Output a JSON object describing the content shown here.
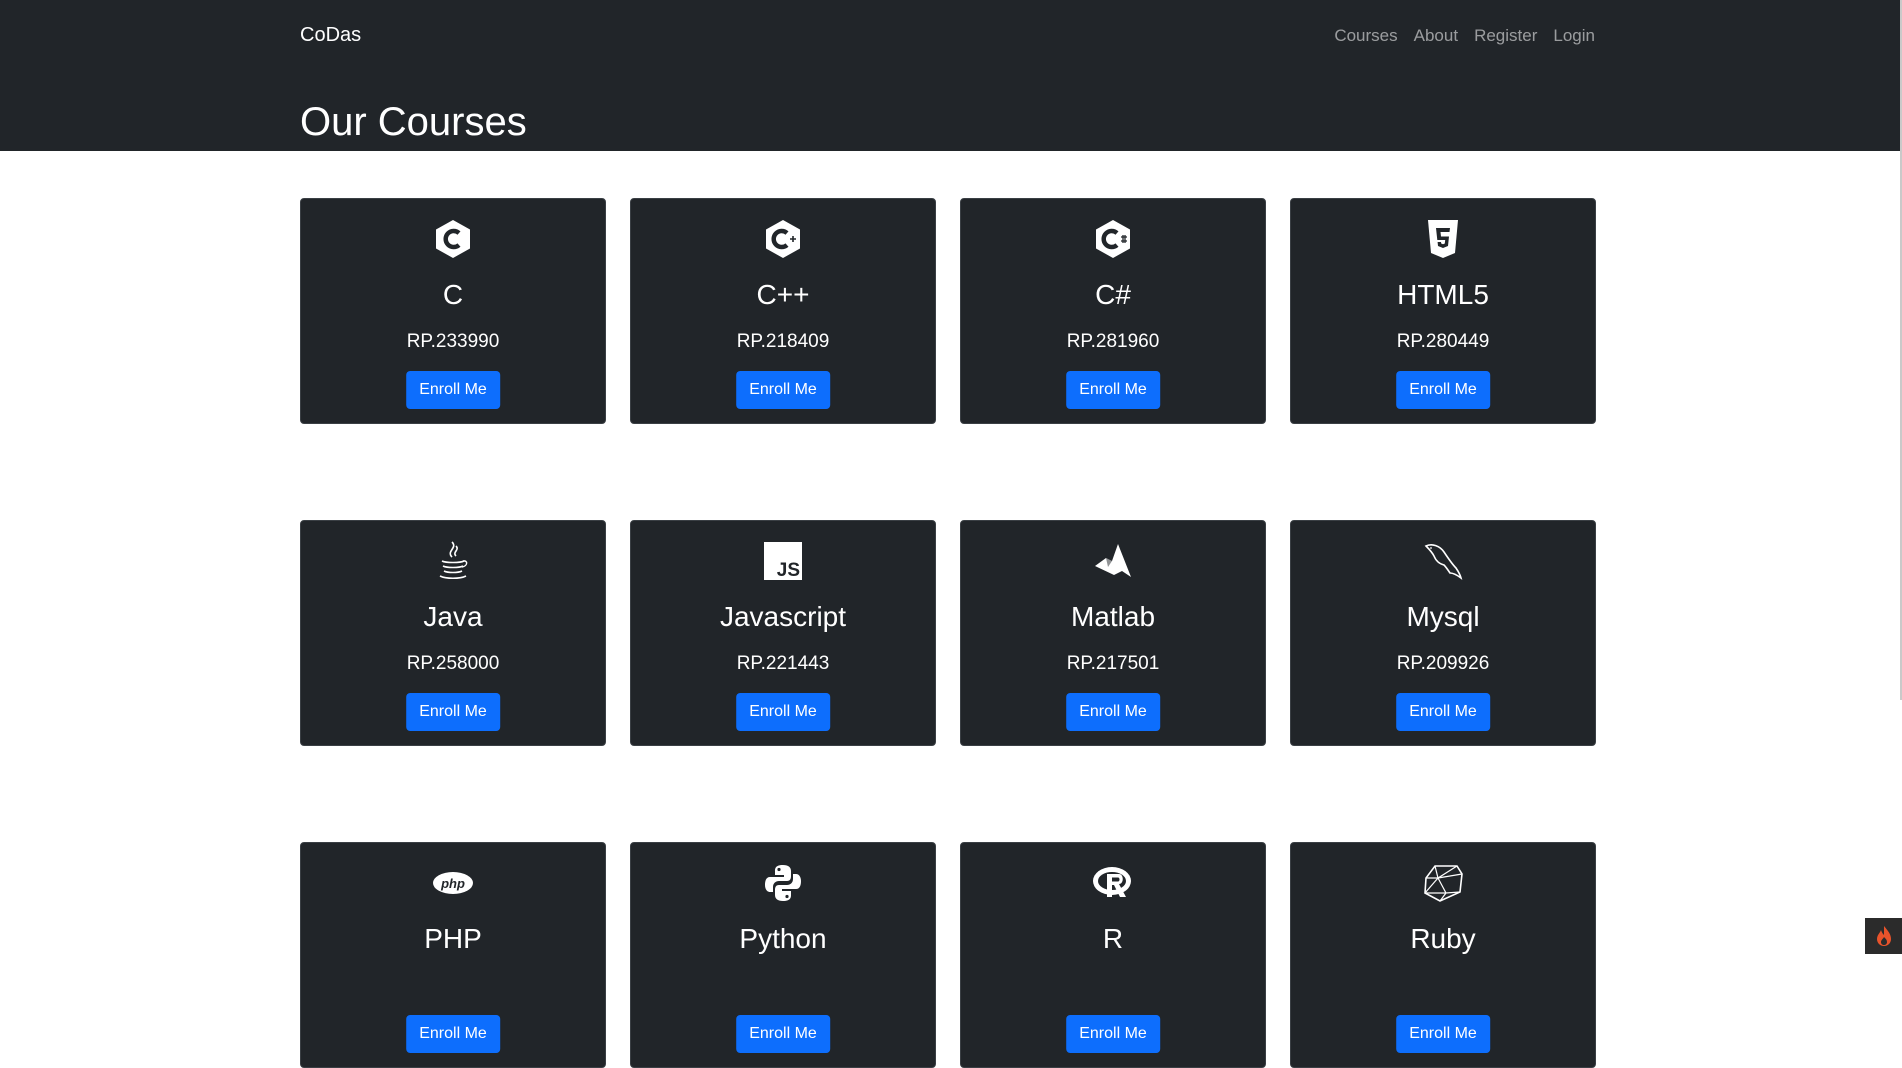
{
  "navbar": {
    "brand": "CoDas",
    "links": [
      "Courses",
      "About",
      "Register",
      "Login"
    ]
  },
  "page": {
    "title": "Our Courses"
  },
  "courses": [
    {
      "name": "C",
      "price": "RP.233990",
      "icon": "c-language-icon"
    },
    {
      "name": "C++",
      "price": "RP.218409",
      "icon": "cplusplus-icon"
    },
    {
      "name": "C#",
      "price": "RP.281960",
      "icon": "csharp-icon"
    },
    {
      "name": "HTML5",
      "price": "RP.280449",
      "icon": "html5-icon"
    },
    {
      "name": "Java",
      "price": "RP.258000",
      "icon": "java-icon"
    },
    {
      "name": "Javascript",
      "price": "RP.221443",
      "icon": "javascript-icon"
    },
    {
      "name": "Matlab",
      "price": "RP.217501",
      "icon": "matlab-icon"
    },
    {
      "name": "Mysql",
      "price": "RP.209926",
      "icon": "mysql-icon"
    },
    {
      "name": "PHP",
      "price": "",
      "icon": "php-icon"
    },
    {
      "name": "Python",
      "price": "",
      "icon": "python-icon"
    },
    {
      "name": "R",
      "price": "",
      "icon": "r-language-icon"
    },
    {
      "name": "Ruby",
      "price": "",
      "icon": "ruby-icon"
    }
  ],
  "buttons": {
    "enroll_label": "Enroll Me"
  },
  "colors": {
    "header_bg": "#212529",
    "card_bg": "#212529",
    "button_bg": "#0d6efd",
    "page_bg": "#ffffff"
  }
}
